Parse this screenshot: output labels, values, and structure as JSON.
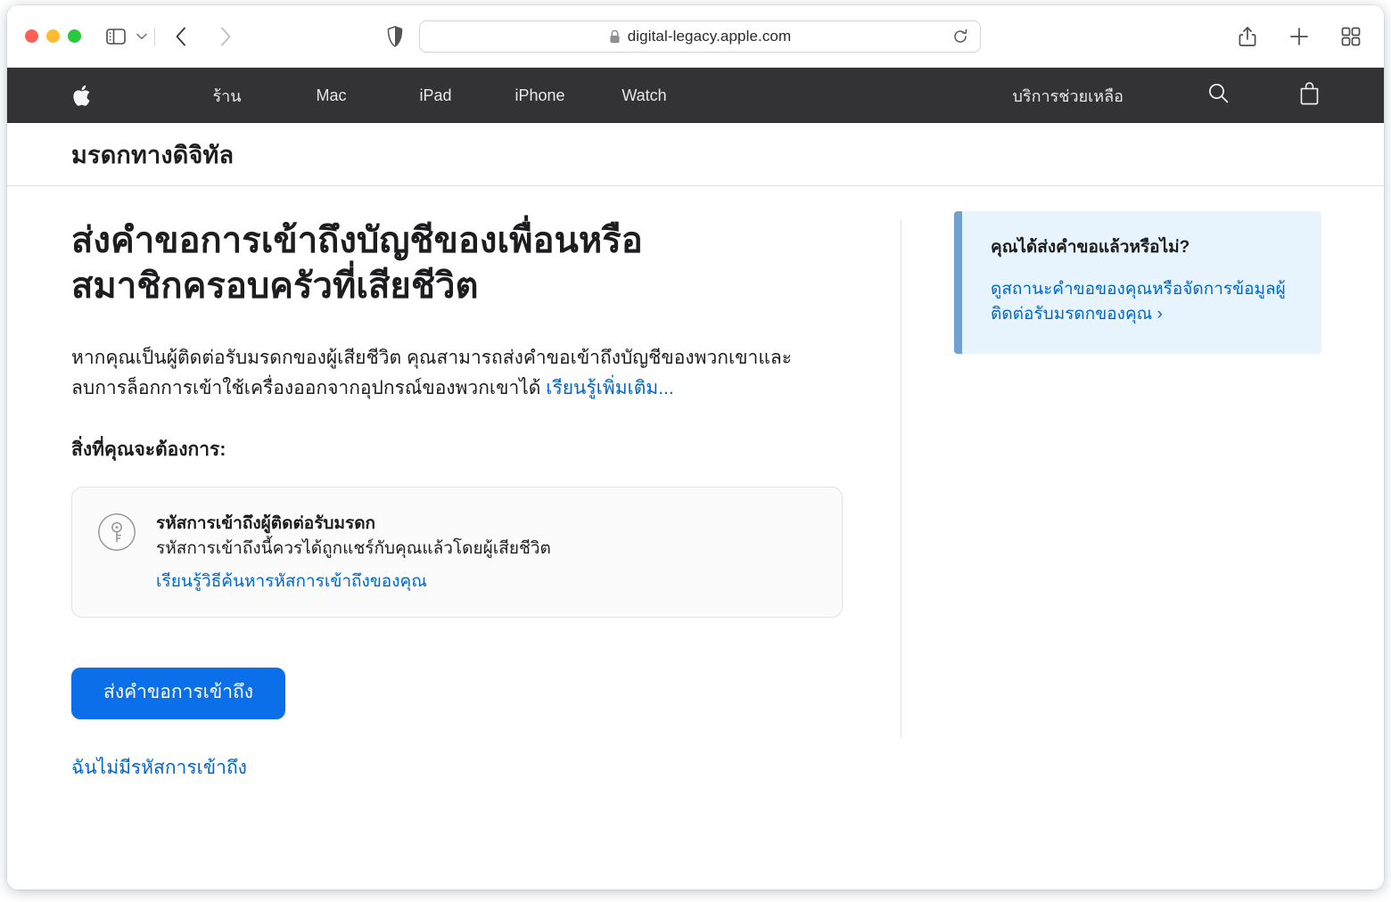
{
  "browser": {
    "url": "digital-legacy.apple.com",
    "lock_icon": "lock-icon",
    "reload_icon": "reload-icon",
    "sidebar_icon": "sidebar-toggle-icon",
    "dropdown_icon": "chevron-down-icon",
    "back_icon": "back-chevron-icon",
    "forward_icon": "forward-chevron-icon",
    "shield_icon": "privacy-shield-icon",
    "share_icon": "share-icon",
    "new_tab_icon": "plus-icon",
    "tab_overview_icon": "tab-overview-icon",
    "traffic_lights": [
      "close",
      "minimize",
      "maximize"
    ]
  },
  "globalnav": {
    "logo": "apple-logo",
    "items": [
      {
        "label": "ร้าน"
      },
      {
        "label": "Mac"
      },
      {
        "label": "iPad"
      },
      {
        "label": "iPhone"
      },
      {
        "label": "Watch"
      }
    ],
    "support_label": "บริการช่วยเหลือ",
    "search_icon": "search-icon",
    "bag_icon": "shopping-bag-icon"
  },
  "localnav": {
    "title": "มรดกทางดิจิทัล"
  },
  "main": {
    "heading": "ส่งคำขอการเข้าถึงบัญชีของเพื่อนหรือสมาชิกครอบครัวที่เสียชีวิต",
    "intro_text": "หากคุณเป็นผู้ติดต่อรับมรดกของผู้เสียชีวิต คุณสามารถส่งคำขอเข้าถึงบัญชีของพวกเขาและลบการล็อกการเข้าใช้เครื่องออกจากอุปกรณ์ของพวกเขาได้ ",
    "intro_link": "เรียนรู้เพิ่มเติม...",
    "need_label": "สิ่งที่คุณจะต้องการ:",
    "card": {
      "icon": "key-icon",
      "title": "รหัสการเข้าถึงผู้ติดต่อรับมรดก",
      "description": "รหัสการเข้าถึงนี้ควรได้ถูกแชร์กับคุณแล้วโดยผู้เสียชีวิต",
      "link": "เรียนรู้วิธีค้นหารหัสการเข้าถึงของคุณ"
    },
    "primary_button": "ส่งคำขอการเข้าถึง",
    "secondary_link": "ฉันไม่มีรหัสการเข้าถึง"
  },
  "sidebar": {
    "callout_title": "คุณได้ส่งคำขอแล้วหรือไม่?",
    "callout_link": "ดูสถานะคำขอของคุณหรือจัดการข้อมูลผู้ติดต่อรับมรดกของคุณ ›"
  },
  "colors": {
    "accent_blue": "#0066cc",
    "button_blue": "#0a6fe8",
    "nav_dark": "#333336",
    "callout_bg": "#e8f4fd",
    "callout_border": "#6fa0cf"
  }
}
